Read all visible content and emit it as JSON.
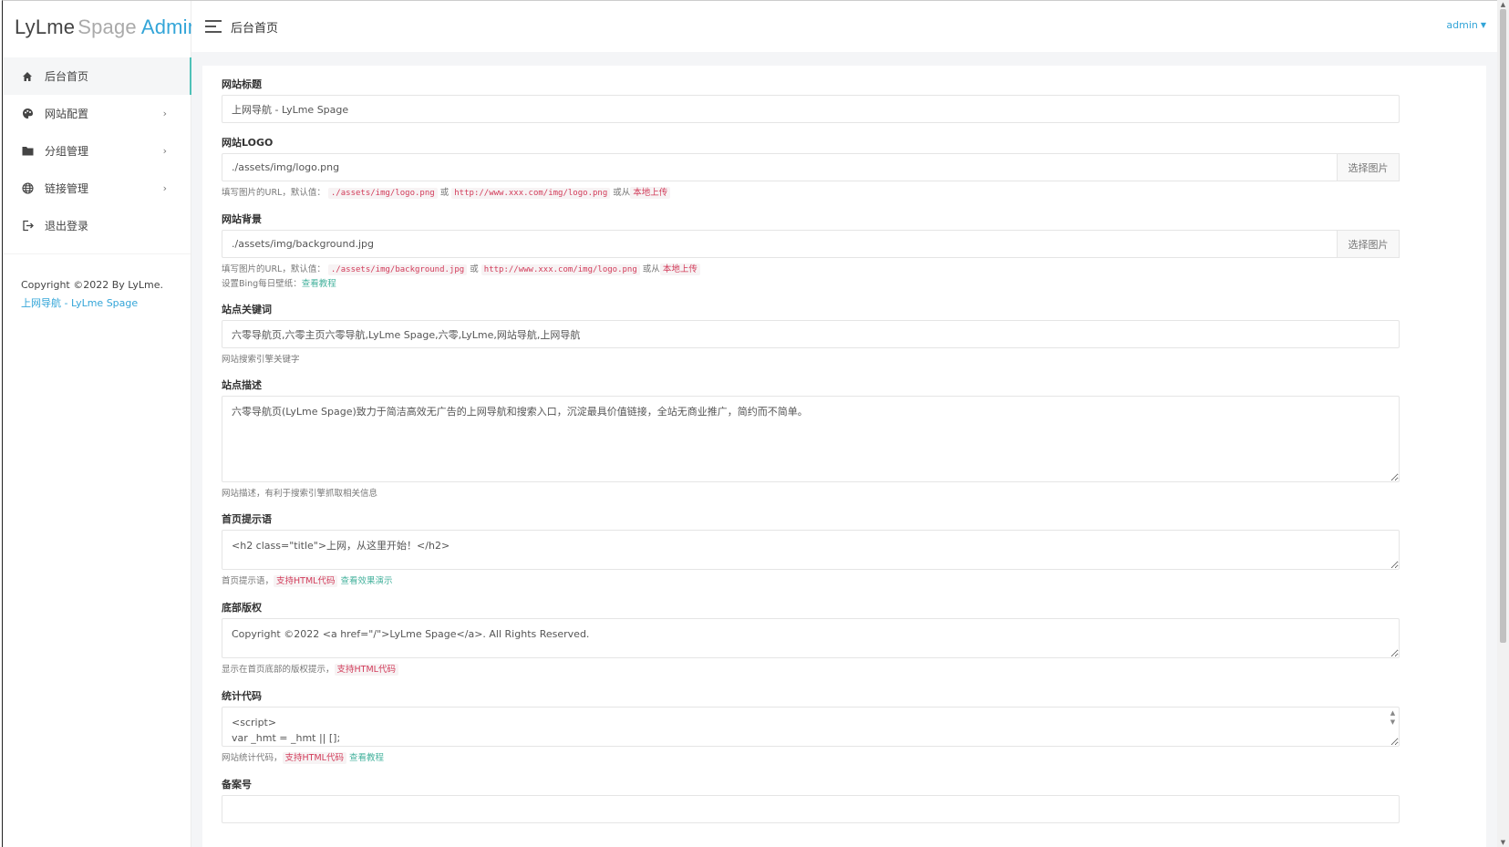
{
  "brand": {
    "part1": "LyLme",
    "part2": "Spage",
    "part3": "Admin"
  },
  "header": {
    "title": "后台首页",
    "user": "admin"
  },
  "sidebar": {
    "items": [
      {
        "label": "后台首页",
        "icon": "home-icon",
        "active": true
      },
      {
        "label": "网站配置",
        "icon": "palette-icon",
        "arrow": true
      },
      {
        "label": "分组管理",
        "icon": "folder-icon",
        "arrow": true
      },
      {
        "label": "链接管理",
        "icon": "globe-icon",
        "arrow": true
      },
      {
        "label": "退出登录",
        "icon": "logout-icon"
      }
    ],
    "footer_copy": "Copyright ©2022 By LyLme.",
    "footer_link": "上网导航 - LyLme Spage"
  },
  "form": {
    "title": {
      "label": "网站标题",
      "value": "上网导航 - LyLme Spage"
    },
    "logo": {
      "label": "网站LOGO",
      "value": "./assets/img/logo.png",
      "button": "选择图片",
      "help_prefix": "填写图片的URL，默认值：",
      "code1": "./assets/img/logo.png",
      "or": "或",
      "code2": "http://www.xxx.com/img/logo.png",
      "or_from": "或从",
      "upload": "本地上传"
    },
    "background": {
      "label": "网站背景",
      "value": "./assets/img/background.jpg",
      "button": "选择图片",
      "help_prefix": "填写图片的URL，默认值：",
      "code1": "./assets/img/background.jpg",
      "or": "或",
      "code2": "http://www.xxx.com/img/logo.png",
      "or_from": "或从",
      "upload": "本地上传",
      "bing_prefix": "设置Bing每日壁纸：",
      "bing_link": "查看教程"
    },
    "keywords": {
      "label": "站点关键词",
      "value": "六零导航页,六零主页六零导航,LyLme Spage,六零,LyLme,网站导航,上网导航",
      "help": "网站搜索引擎关键字"
    },
    "description": {
      "label": "站点描述",
      "value": "六零导航页(LyLme Spage)致力于简洁高效无广告的上网导航和搜索入口，沉淀最具价值链接，全站无商业推广，简约而不简单。",
      "help": "网站描述，有利于搜索引擎抓取相关信息"
    },
    "home_tip": {
      "label": "首页提示语",
      "value": "<h2 class=\"title\">上网，从这里开始！</h2>",
      "help_prefix": "首页提示语，",
      "html_tag": "支持HTML代码",
      "demo_link": "查看效果演示"
    },
    "copyright": {
      "label": "底部版权",
      "value": "Copyright ©2022 <a href=\"/\">LyLme Spage</a>. All Rights Reserved.",
      "help_prefix": "显示在首页底部的版权提示，",
      "html_tag": "支持HTML代码"
    },
    "stats": {
      "label": "统计代码",
      "value": "<script>\nvar _hmt = _hmt || [];",
      "help_prefix": "网站统计代码，",
      "html_tag": "支持HTML代码",
      "tutorial_link": "查看教程"
    },
    "icp": {
      "label": "备案号"
    }
  }
}
